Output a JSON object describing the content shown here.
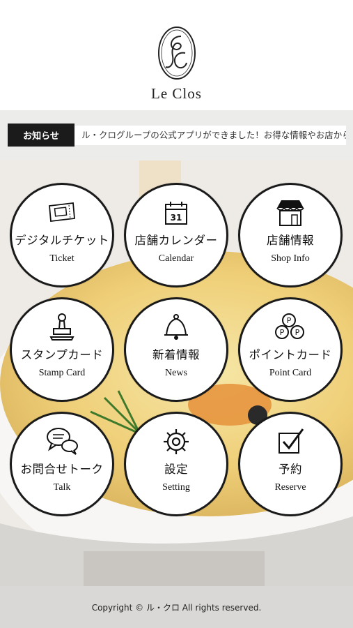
{
  "header": {
    "logo_text": "Le Clos"
  },
  "news": {
    "label": "お知らせ",
    "ticker": "ル・クログループの公式アプリができました！お得な情報やお店からの"
  },
  "menu": [
    {
      "jp": "デジタルチケット",
      "en": "Ticket",
      "icon": "ticket-icon"
    },
    {
      "jp": "店舗カレンダー",
      "en": "Calendar",
      "icon": "calendar-icon",
      "day": "31"
    },
    {
      "jp": "店舗情報",
      "en": "Shop Info",
      "icon": "shop-icon"
    },
    {
      "jp": "スタンプカード",
      "en": "Stamp Card",
      "icon": "stamp-icon"
    },
    {
      "jp": "新着情報",
      "en": "News",
      "icon": "bell-icon"
    },
    {
      "jp": "ポイントカード",
      "en": "Point Card",
      "icon": "coins-icon",
      "coin_letter": "P"
    },
    {
      "jp": "お問合せトーク",
      "en": "Talk",
      "icon": "chat-bubbles-icon"
    },
    {
      "jp": "設定",
      "en": "Setting",
      "icon": "gear-icon"
    },
    {
      "jp": "予約",
      "en": "Reserve",
      "icon": "checkbox-icon"
    }
  ],
  "footer": {
    "copyright": "Copyright © ル・クロ All rights reserved."
  }
}
